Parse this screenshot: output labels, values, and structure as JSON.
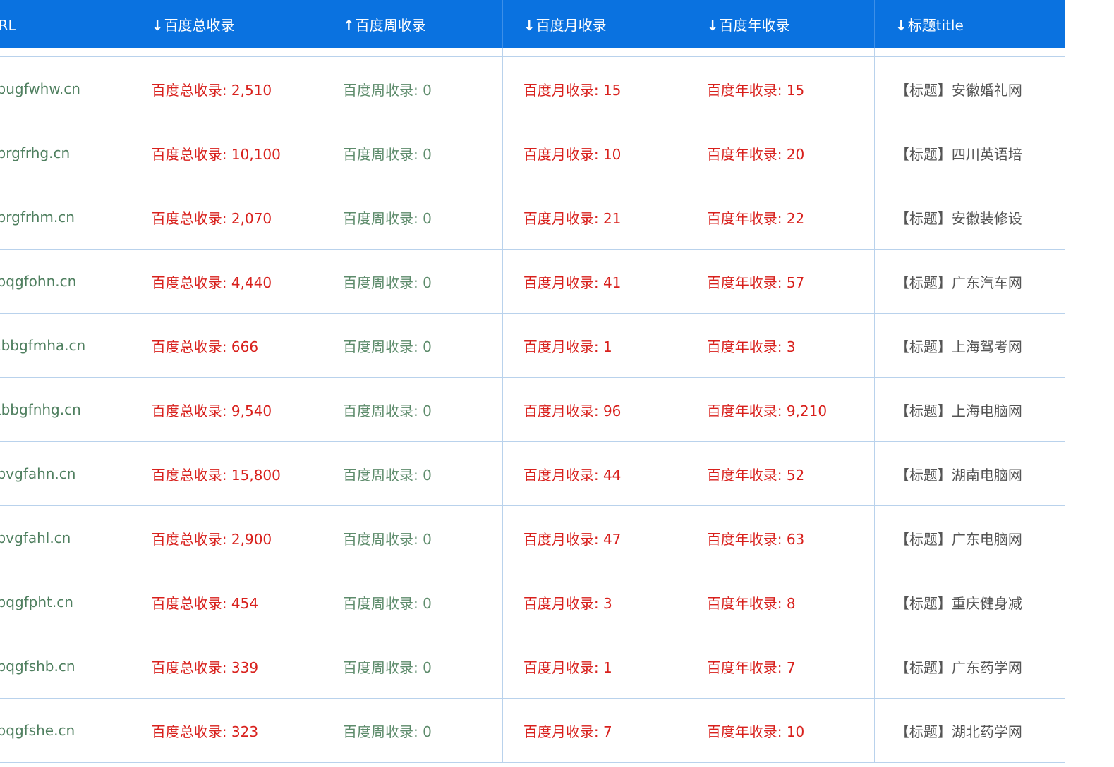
{
  "columns": {
    "url": {
      "arrow": "",
      "label": "询URL"
    },
    "total": {
      "arrow": "↓",
      "label": "百度总收录"
    },
    "week": {
      "arrow": "↑",
      "label": "百度周收录"
    },
    "month": {
      "arrow": "↓",
      "label": "百度月收录"
    },
    "year": {
      "arrow": "↓",
      "label": "百度年收录"
    },
    "title": {
      "arrow": "↓",
      "label": "标题title"
    }
  },
  "rows": [
    {
      "url": "jbugfwhw.cn",
      "total": "百度总收录: 2,510",
      "week": "百度周收录: 0",
      "month": "百度月收录: 15",
      "year": "百度年收录: 15",
      "title": "【标题】安徽婚礼网"
    },
    {
      "url": "jbrgfrhg.cn",
      "total": "百度总收录: 10,100",
      "week": "百度周收录: 0",
      "month": "百度月收录: 10",
      "year": "百度年收录: 20",
      "title": "【标题】四川英语培"
    },
    {
      "url": "jbrgfrhm.cn",
      "total": "百度总收录: 2,070",
      "week": "百度周收录: 0",
      "month": "百度月收录: 21",
      "year": "百度年收录: 22",
      "title": "【标题】安徽装修设"
    },
    {
      "url": "jbqgfohn.cn",
      "total": "百度总收录: 4,440",
      "week": "百度周收录: 0",
      "month": "百度月收录: 41",
      "year": "百度年收录: 57",
      "title": "【标题】广东汽车网"
    },
    {
      "url": "kbbgfmha.cn",
      "total": "百度总收录: 666",
      "week": "百度周收录: 0",
      "month": "百度月收录: 1",
      "year": "百度年收录: 3",
      "title": "【标题】上海驾考网"
    },
    {
      "url": "kbbgfnhg.cn",
      "total": "百度总收录: 9,540",
      "week": "百度周收录: 0",
      "month": "百度月收录: 96",
      "year": "百度年收录: 9,210",
      "title": "【标题】上海电脑网"
    },
    {
      "url": "jbvgfahn.cn",
      "total": "百度总收录: 15,800",
      "week": "百度周收录: 0",
      "month": "百度月收录: 44",
      "year": "百度年收录: 52",
      "title": "【标题】湖南电脑网"
    },
    {
      "url": "jbvgfahl.cn",
      "total": "百度总收录: 2,900",
      "week": "百度周收录: 0",
      "month": "百度月收录: 47",
      "year": "百度年收录: 63",
      "title": "【标题】广东电脑网"
    },
    {
      "url": "jbqgfpht.cn",
      "total": "百度总收录: 454",
      "week": "百度周收录: 0",
      "month": "百度月收录: 3",
      "year": "百度年收录: 8",
      "title": "【标题】重庆健身减"
    },
    {
      "url": "jbqgfshb.cn",
      "total": "百度总收录: 339",
      "week": "百度周收录: 0",
      "month": "百度月收录: 1",
      "year": "百度年收录: 7",
      "title": "【标题】广东药学网"
    },
    {
      "url": "jbqgfshe.cn",
      "total": "百度总收录: 323",
      "week": "百度周收录: 0",
      "month": "百度月收录: 7",
      "year": "百度年收录: 10",
      "title": "【标题】湖北药学网"
    }
  ]
}
